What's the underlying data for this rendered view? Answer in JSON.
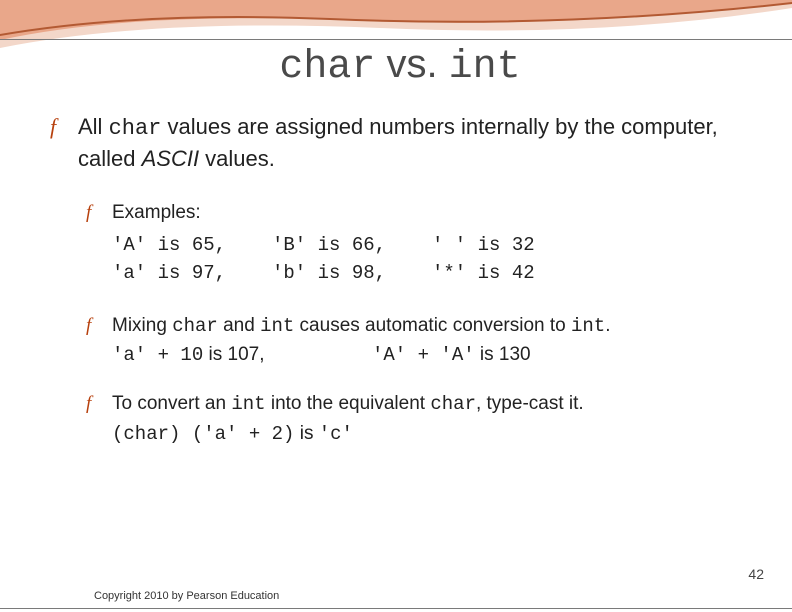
{
  "title_parts": {
    "t1": "char",
    "t2": " vs. ",
    "t3": "int"
  },
  "bullet_all": {
    "pre": "All ",
    "char": "char",
    "post1": " values are assigned numbers internally by the computer, called ",
    "ascii": "ASCII",
    "post2": " values."
  },
  "examples_label": "Examples:",
  "examples": [
    {
      "c1": "'A' is 65,",
      "c2": "'B' is 66,",
      "c3": "' ' is 32"
    },
    {
      "c1": "'a' is 97,",
      "c2": "'b' is 98,",
      "c3": "'*' is 42"
    }
  ],
  "mixing": {
    "pre": "Mixing ",
    "c1": "char",
    "mid1": " and ",
    "c2": "int",
    "mid2": " causes automatic conversion to ",
    "c3": "int",
    "post": "."
  },
  "mixing_rows": [
    {
      "expr": "'a' + 10",
      "is": " is 107,"
    },
    {
      "expr": "'A' + 'A'",
      "is": " is 130"
    }
  ],
  "convert": {
    "pre": "To convert an ",
    "c1": "int",
    "mid1": " into the equivalent ",
    "c2": "char",
    "post": ", type-cast it."
  },
  "convert_row": {
    "expr": "(char) ('a' + 2)",
    "is": " is ",
    "res": "'c'"
  },
  "page_number": "42",
  "copyright": "Copyright 2010 by Pearson Education",
  "glyph": "f"
}
